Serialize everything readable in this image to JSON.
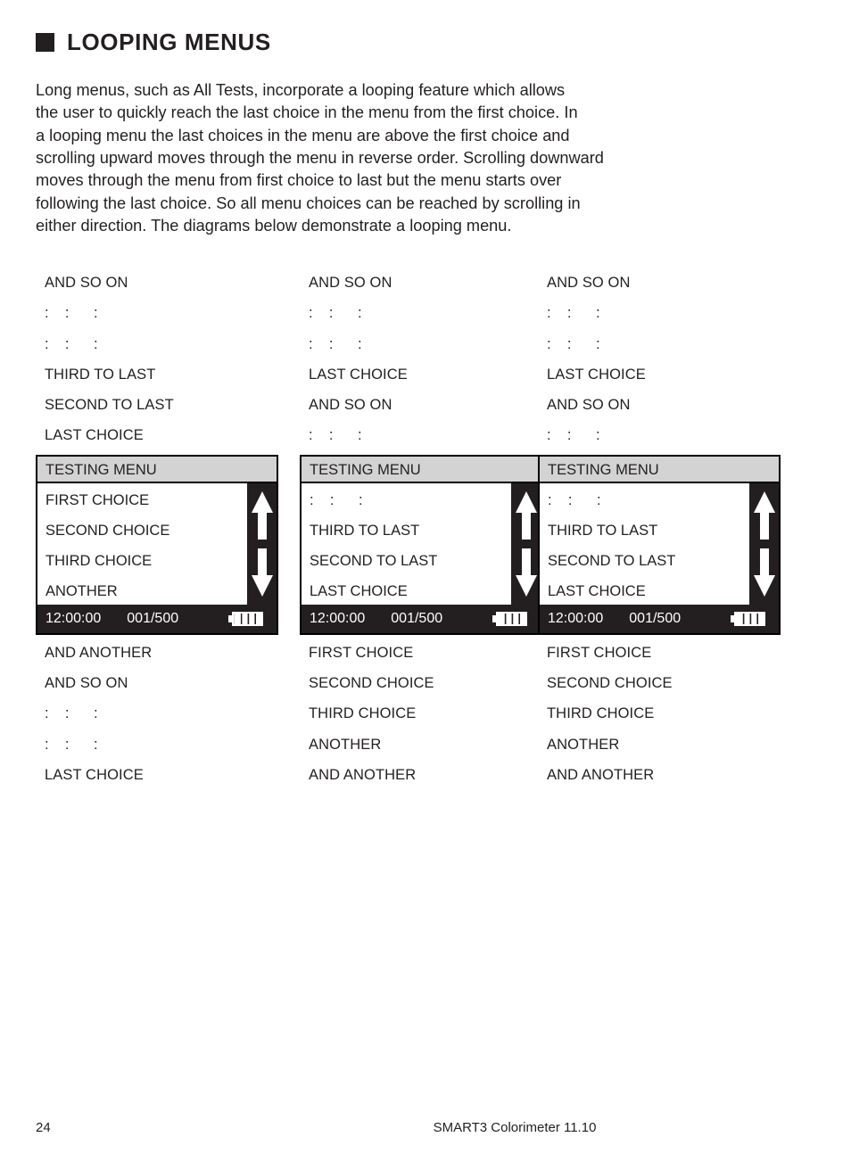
{
  "heading": {
    "bullet": "square-bullet",
    "title": "LOOPING MENUS"
  },
  "intro": {
    "paragraph": "Long menus, such as All Tests, incorporate a looping feature which allows\nthe user to quickly reach the last choice in the menu from the first choice. In\na looping menu the last choices in the menu are above the first choice and\nscrolling upward moves through the menu in reverse order. Scrolling downward\nmoves through the menu from first choice to last but the menu starts over\nfollowing the last choice. So all menu choices can be reached by scrolling in\neither direction. The diagrams below demonstrate a looping menu."
  },
  "dots_line": ":    :      :",
  "diagrams": [
    {
      "id": "diagram-1",
      "above": [
        "AND SO ON",
        ":    :      :",
        ":    :      :",
        "THIRD TO LAST",
        "SECOND TO LAST",
        "LAST CHOICE"
      ],
      "screen": {
        "title": "TESTING MENU",
        "items": [
          "FIRST CHOICE",
          "SECOND CHOICE",
          "THIRD CHOICE",
          "ANOTHER"
        ],
        "status": {
          "time": "12:00:00",
          "count": "001/500",
          "battery": "battery-full-icon"
        },
        "scroll": {
          "up": "arrow-up-icon",
          "down": "arrow-down-icon"
        }
      },
      "below": [
        "AND ANOTHER",
        "AND SO ON",
        ":    :      :",
        ":    :      :",
        "LAST CHOICE"
      ]
    },
    {
      "id": "diagram-2",
      "above": [
        "AND SO ON",
        ":    :      :",
        ":    :      :",
        "LAST CHOICE",
        "AND SO ON",
        ":    :      :"
      ],
      "screen": {
        "title": "TESTING MENU",
        "items": [
          ":    :      :",
          "THIRD TO LAST",
          "SECOND TO LAST",
          "LAST CHOICE"
        ],
        "status": {
          "time": "12:00:00",
          "count": "001/500",
          "battery": "battery-full-icon"
        },
        "scroll": {
          "up": "arrow-up-icon",
          "down": "arrow-down-icon"
        }
      },
      "below": [
        "FIRST CHOICE",
        "SECOND CHOICE",
        "THIRD CHOICE",
        "ANOTHER",
        "AND ANOTHER"
      ]
    },
    {
      "id": "diagram-3",
      "above": [
        "AND SO ON",
        ":    :      :",
        ":    :      :",
        "LAST CHOICE",
        "AND SO ON",
        ":    :      :"
      ],
      "screen": {
        "title": "TESTING MENU",
        "items": [
          ":    :      :",
          "THIRD TO LAST",
          "SECOND TO LAST",
          "LAST CHOICE"
        ],
        "status": {
          "time": "12:00:00",
          "count": "001/500",
          "battery": "battery-full-icon"
        },
        "scroll": {
          "up": "arrow-up-icon",
          "down": "arrow-down-icon"
        }
      },
      "below": [
        "FIRST CHOICE",
        "SECOND CHOICE",
        "THIRD CHOICE",
        "ANOTHER",
        "AND ANOTHER"
      ]
    }
  ],
  "footer": {
    "page_number": "24",
    "doc_title": "SMART3 Colorimeter 11.10"
  },
  "colors": {
    "ink": "#231f20",
    "screen_header": "#d3d3d3",
    "screen_chrome": "#231f20",
    "page_background": "#ffffff"
  }
}
